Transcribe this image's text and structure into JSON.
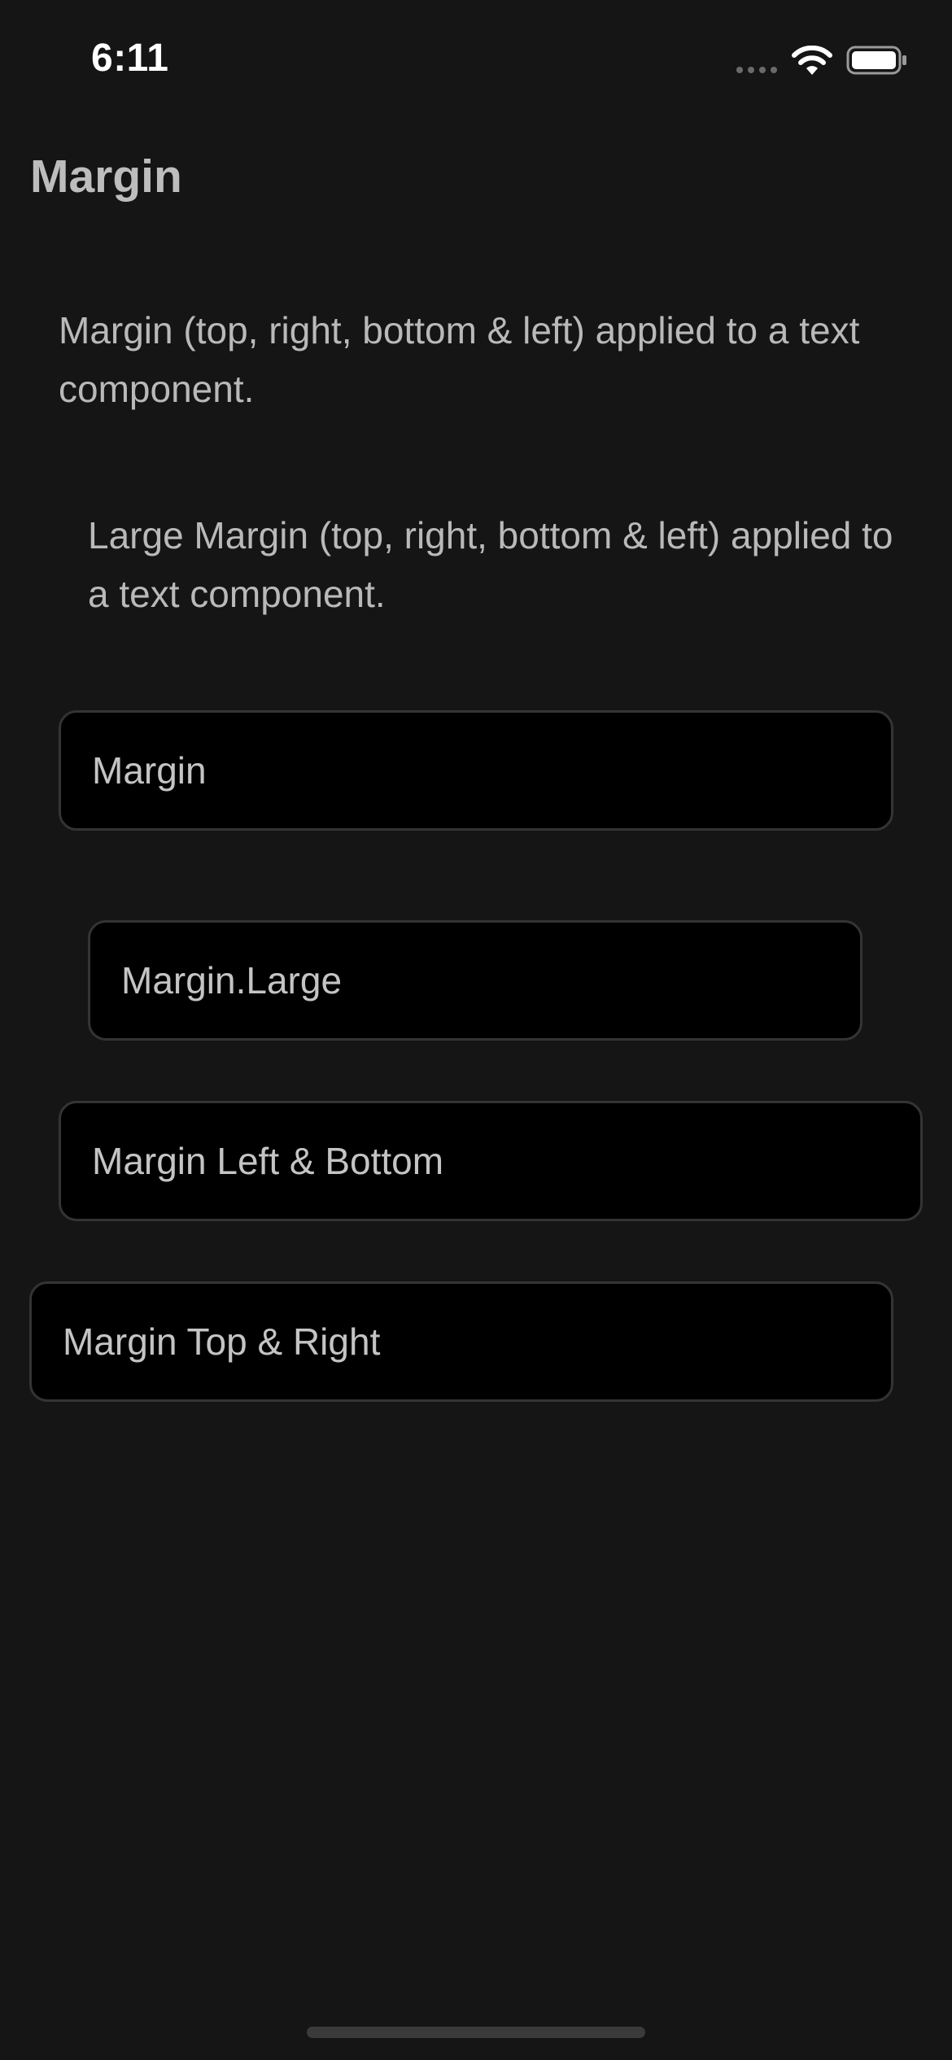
{
  "status_bar": {
    "time": "6:11",
    "icons": [
      "signal-dots-icon",
      "wifi-icon",
      "battery-icon"
    ]
  },
  "header": {
    "title": "Margin"
  },
  "content": {
    "paragraph_margin": "Margin (top, right, bottom & left) applied to a text component.",
    "paragraph_large_margin": "Large Margin (top, right, bottom & left) applied to a text component.",
    "boxes": [
      {
        "label": "Margin"
      },
      {
        "label": "Margin.Large"
      },
      {
        "label": "Margin Left & Bottom"
      },
      {
        "label": "Margin Top & Right"
      }
    ]
  },
  "colors": {
    "background": "#151515",
    "box_background": "#000000",
    "box_border": "#343434",
    "text": "#c4c4c4"
  }
}
